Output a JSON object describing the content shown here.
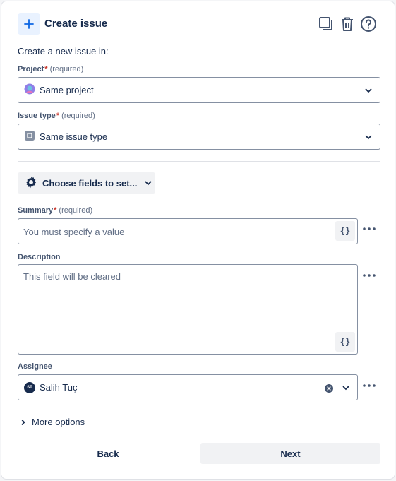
{
  "header": {
    "title": "Create issue",
    "add_icon": "plus-icon",
    "actions": [
      "duplicate-icon",
      "trash-icon",
      "help-icon"
    ]
  },
  "intro": "Create a new issue in:",
  "project": {
    "label": "Project",
    "required_marker": "*",
    "required_text": "(required)",
    "value": "Same project",
    "icon": "project-avatar-icon"
  },
  "issue_type": {
    "label": "Issue type",
    "required_marker": "*",
    "required_text": "(required)",
    "value": "Same issue type",
    "icon": "issue-type-icon"
  },
  "choose_fields": {
    "label": "Choose fields to set...",
    "icon": "gear-icon"
  },
  "summary": {
    "label": "Summary",
    "required_marker": "*",
    "required_text": "(required)",
    "placeholder": "You must specify a value",
    "smart_value": "{}"
  },
  "description": {
    "label": "Description",
    "placeholder": "This field will be cleared",
    "smart_value": "{}"
  },
  "assignee": {
    "label": "Assignee",
    "value": "Salih Tuç",
    "avatar_initials": "ST"
  },
  "more_options": "More options",
  "footer": {
    "back": "Back",
    "next": "Next"
  },
  "colors": {
    "accent": "#0c66e4",
    "required": "#c9372c",
    "button_bg": "#f1f2f4"
  }
}
